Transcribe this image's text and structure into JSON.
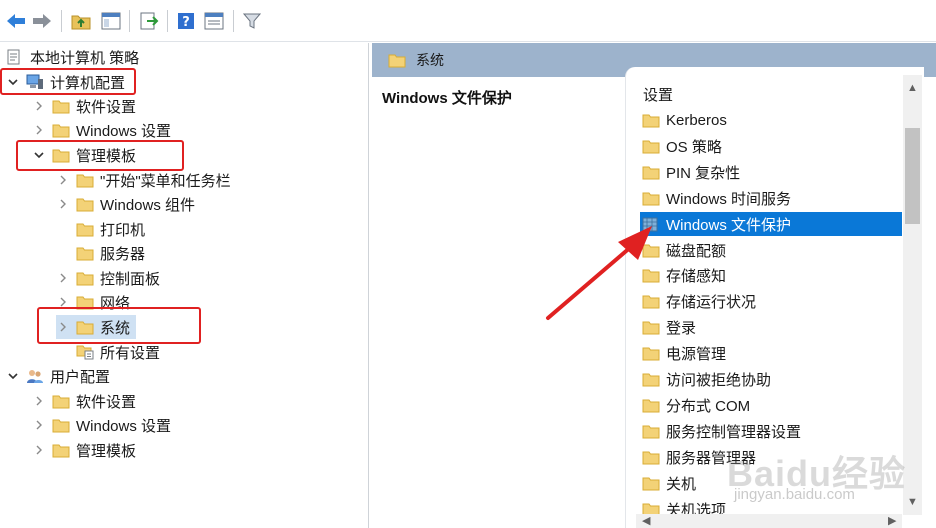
{
  "toolbar": {
    "buttons": [
      "back-icon",
      "forward-icon",
      "up-folder-icon",
      "show-hide-tree-icon",
      "export-list-icon",
      "help-icon",
      "properties-icon",
      "filter-icon"
    ]
  },
  "tree": {
    "root": "本地计算机 策略",
    "computer_config": "计算机配置",
    "cc_software": "软件设置",
    "cc_windows": "Windows 设置",
    "cc_admin": "管理模板",
    "start_menu": "\"开始\"菜单和任务栏",
    "win_components": "Windows 组件",
    "printers": "打印机",
    "servers": "服务器",
    "control_panel": "控制面板",
    "network": "网络",
    "system": "系统",
    "all_settings": "所有设置",
    "user_config": "用户配置",
    "uc_software": "软件设置",
    "uc_windows": "Windows 设置",
    "uc_admin": "管理模板"
  },
  "right": {
    "header_title": "系统",
    "description_title": "Windows 文件保护",
    "list_header": "设置",
    "items": [
      "Kerberos",
      "OS 策略",
      "PIN 复杂性",
      "Windows 时间服务",
      "Windows 文件保护",
      "磁盘配额",
      "存储感知",
      "存储运行状况",
      "登录",
      "电源管理",
      "访问被拒绝协助",
      "分布式 COM",
      "服务控制管理器设置",
      "服务器管理器",
      "关机",
      "关机选项"
    ],
    "selected_index": 4
  },
  "watermark": {
    "brand": "Baidu经验",
    "url": "jingyan.baidu.com"
  },
  "colors": {
    "annotation_red": "#e02121",
    "selection_blue": "#0a78d7",
    "header_blue": "#9db3cc",
    "folder_yellow": "#f3d277"
  }
}
